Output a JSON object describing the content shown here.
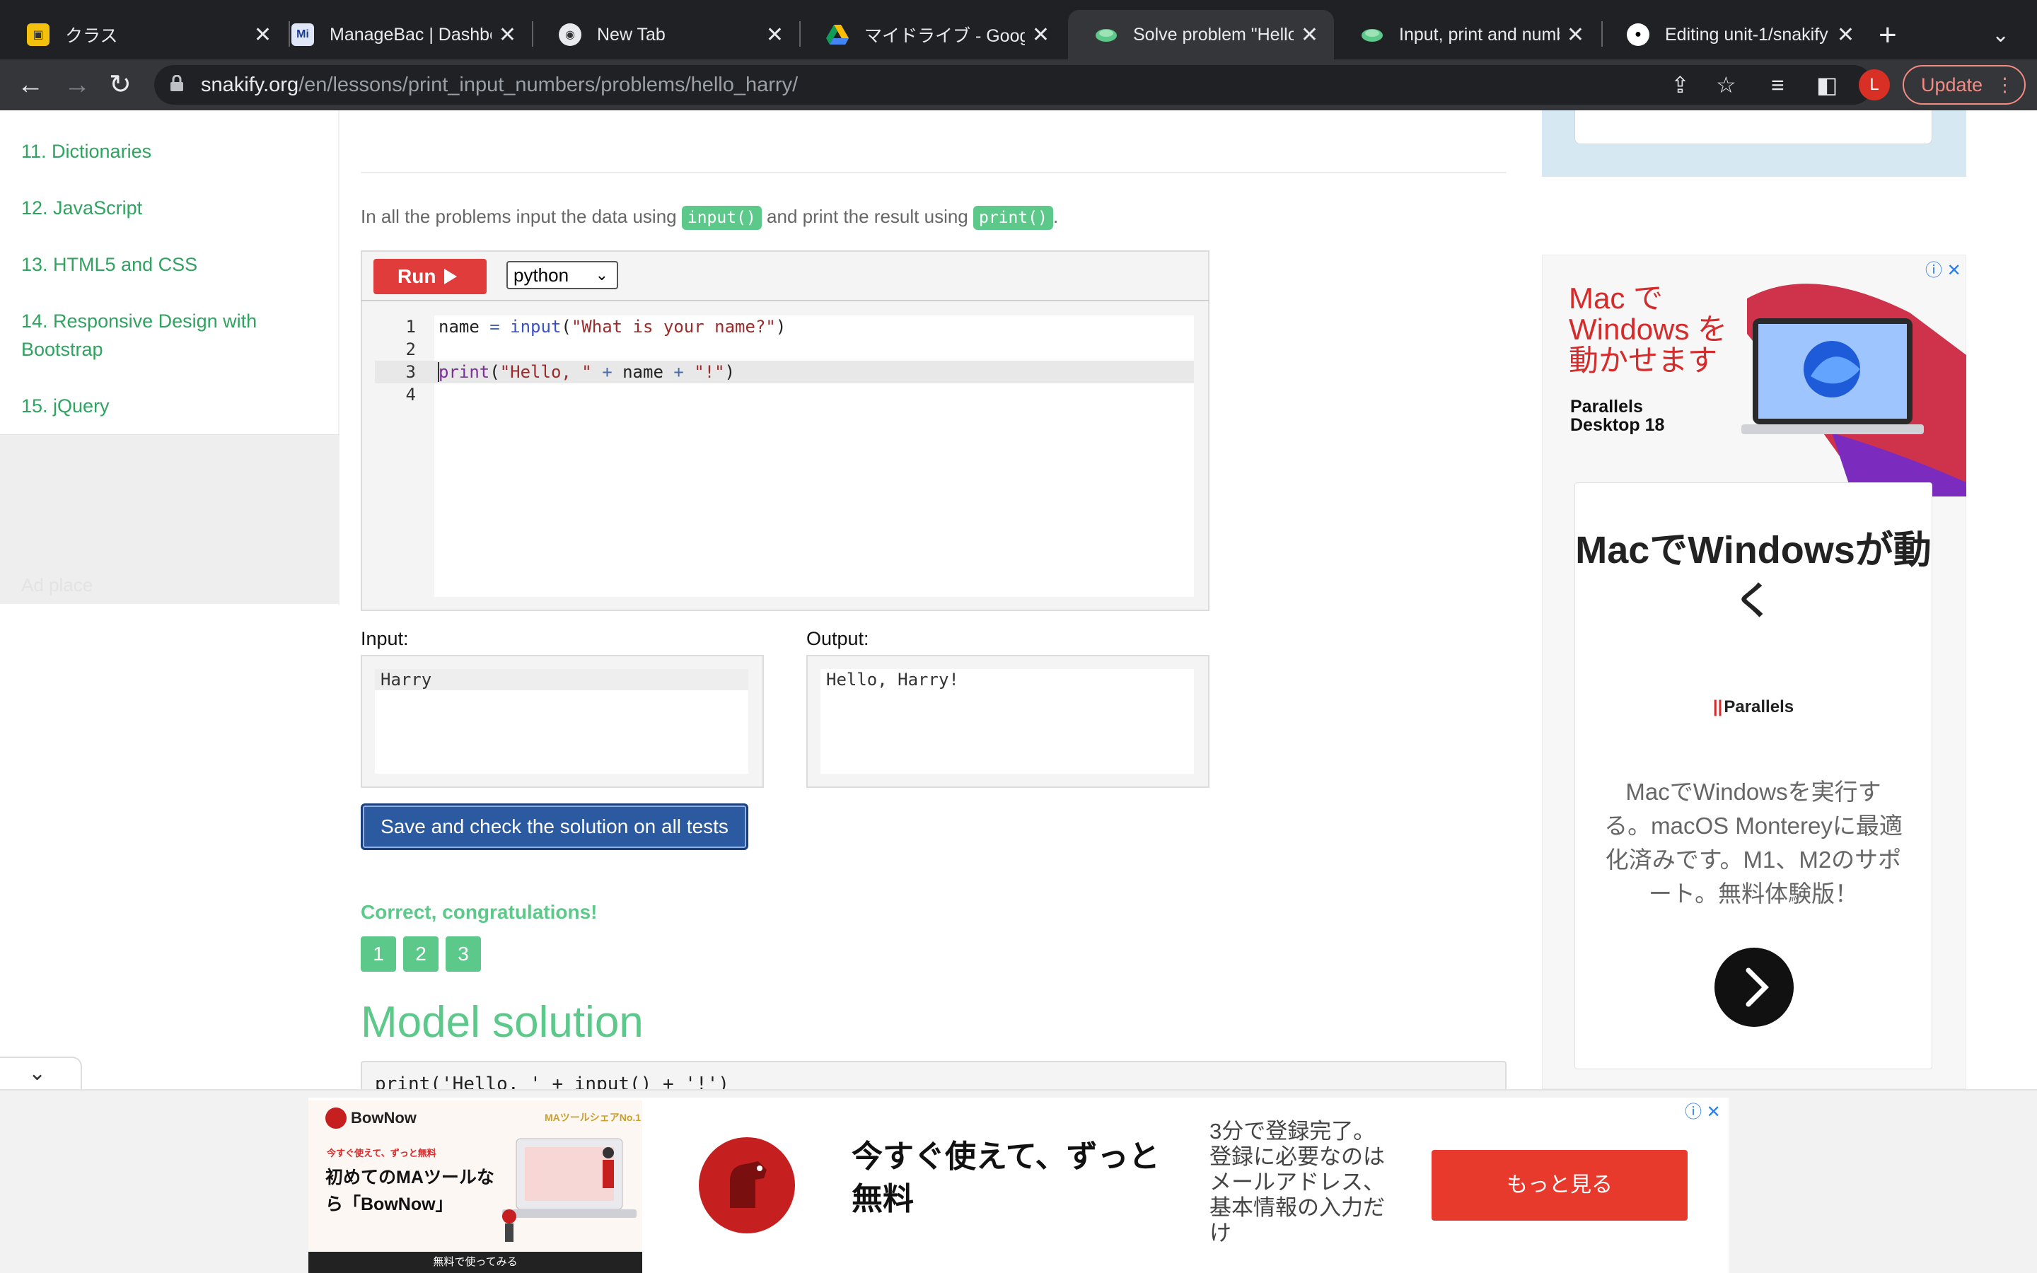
{
  "browser": {
    "tabs": [
      {
        "title": "クラス",
        "favicon": "classroom-icon"
      },
      {
        "title": "ManageBac | Dashboard",
        "favicon": "managebac-icon"
      },
      {
        "title": "New Tab",
        "favicon": "chrome-icon"
      },
      {
        "title": "マイドライブ - Google",
        "favicon": "drive-icon"
      },
      {
        "title": "Solve problem \"Hello, Harry\"",
        "favicon": "snakify-icon",
        "active": true
      },
      {
        "title": "Input, print and numbers",
        "favicon": "snakify-icon"
      },
      {
        "title": "Editing unit-1/snakify",
        "favicon": "github-icon"
      }
    ],
    "url_domain": "snakify.org",
    "url_path": "/en/lessons/print_input_numbers/problems/hello_harry/",
    "avatar_letter": "L",
    "update_label": "Update"
  },
  "sidebar": {
    "items": [
      "11. Dictionaries",
      "12. JavaScript",
      "13. HTML5 and CSS",
      "14. Responsive Design with Bootstrap",
      "15. jQuery"
    ],
    "ad_placeholder": "Ad place"
  },
  "main": {
    "intro_before": "In all the problems input the data using",
    "intro_chip1": "input()",
    "intro_middle": "and print the result using",
    "intro_chip2": "print()",
    "intro_after": ".",
    "run_label": "Run",
    "language": "python",
    "line_numbers": [
      "1",
      "2",
      "3",
      "4"
    ],
    "input_label": "Input:",
    "input_value": "Harry",
    "output_label": "Output:",
    "output_value": "Hello, Harry!",
    "save_label": "Save and check the solution on all tests",
    "success_message": "Correct, congratulations!",
    "tests": [
      "1",
      "2",
      "3"
    ],
    "model_title": "Model solution",
    "model_code": "print('Hello, ' + input() + '!')"
  },
  "right_ad": {
    "title": "Mac で Windows を動かせます",
    "product": "Parallels Desktop 18",
    "heading": "MacでWindowsが動く",
    "brand": "Parallels",
    "body": "MacでWindowsを実行する。macOS Montereyに最適化済みです。M1、M2のサポート。無料体験版！"
  },
  "bottom_ad": {
    "logo": "BowNow",
    "tagline": "今すぐ使えて、ずっと無料",
    "main_copy": "初めてのMAツールなら「BowNow」",
    "badge": "MAツールシェアNo.1",
    "free_strip": "無料で使ってみる",
    "headline": "今すぐ使えて、ずっと無料",
    "description": "3分で登録完了。登録に必要なのはメールアドレス、基本情報の入力だけ",
    "cta": "もっと見る"
  },
  "colors": {
    "snakify_green": "#5cc98a",
    "run_red": "#e03c3c",
    "save_blue": "#2c5aa0",
    "chrome_dark": "#202124"
  }
}
